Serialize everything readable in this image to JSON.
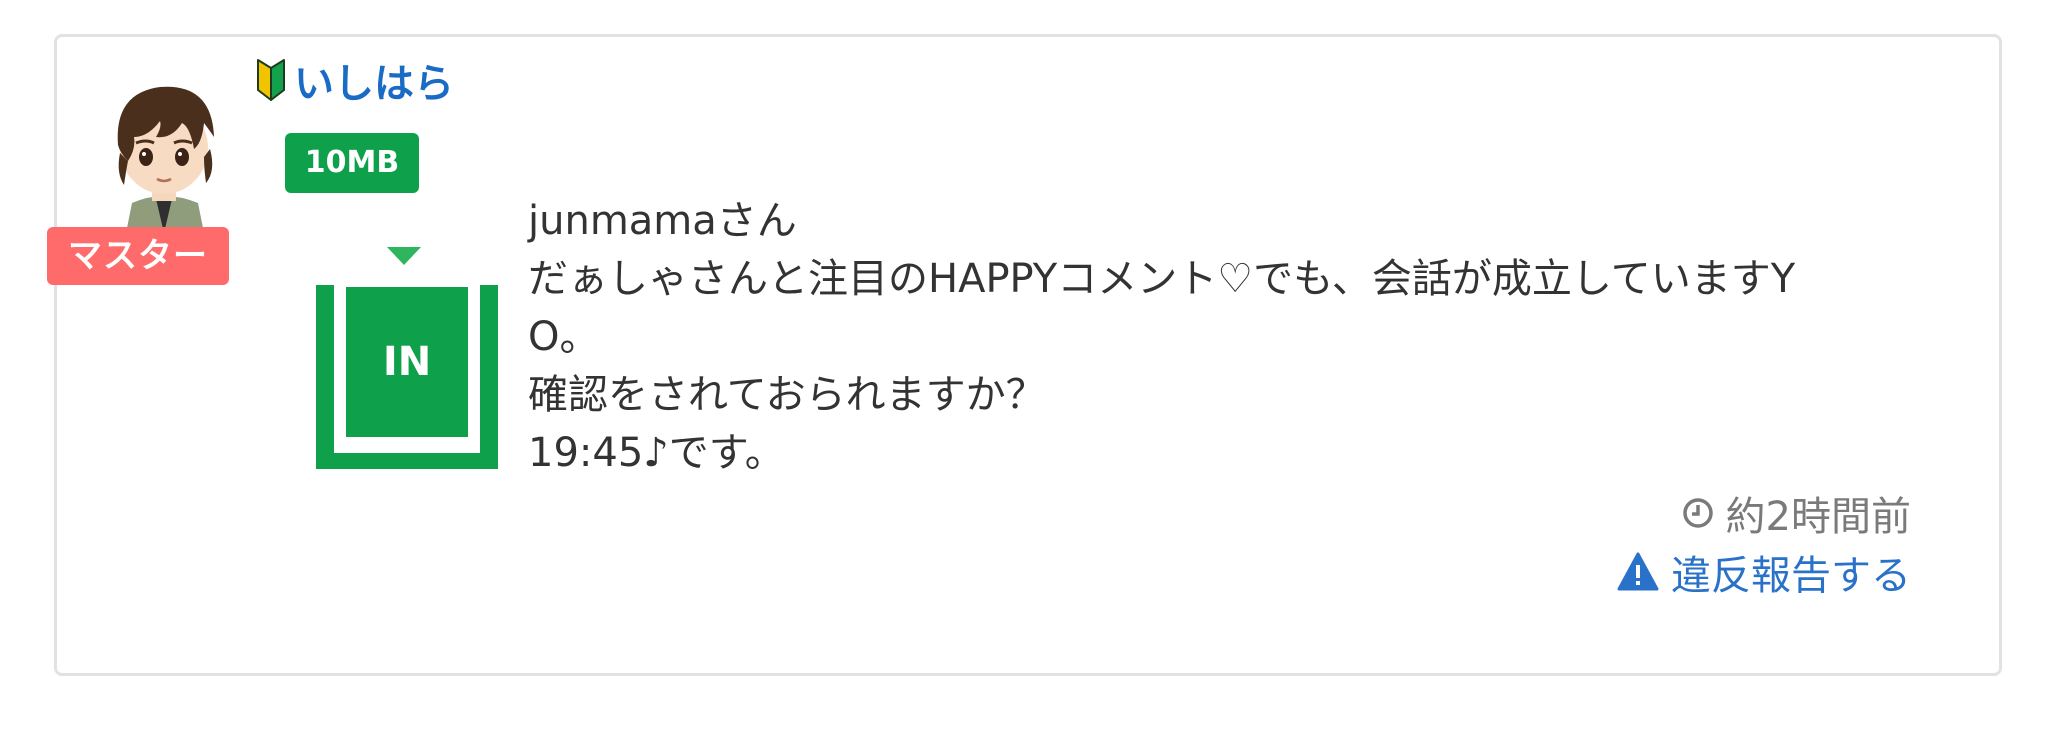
{
  "post": {
    "role_badge": "マスター",
    "username": "いしはら",
    "data_badge": "10MB",
    "in_label": "IN",
    "message_lines": [
      "junmamaさん",
      "だぁしゃさんと注目のHAPPYコメント♡でも、会話が成立していますY",
      "O。",
      "確認をされておられますか？",
      "19:45♪です。"
    ],
    "timestamp": "約2時間前",
    "report_label": "違反報告する"
  },
  "icons": {
    "avatar": "avatar-boy-illustration",
    "beginner": "beginner-mark-icon",
    "clock": "clock-icon",
    "warning": "warning-icon"
  },
  "colors": {
    "username": "#1a6bc4",
    "role_badge": "#ff6b6b",
    "data_green": "#0ea04a",
    "report_link": "#2a72c9",
    "timestamp": "#7a7a7a",
    "text": "#333333"
  }
}
